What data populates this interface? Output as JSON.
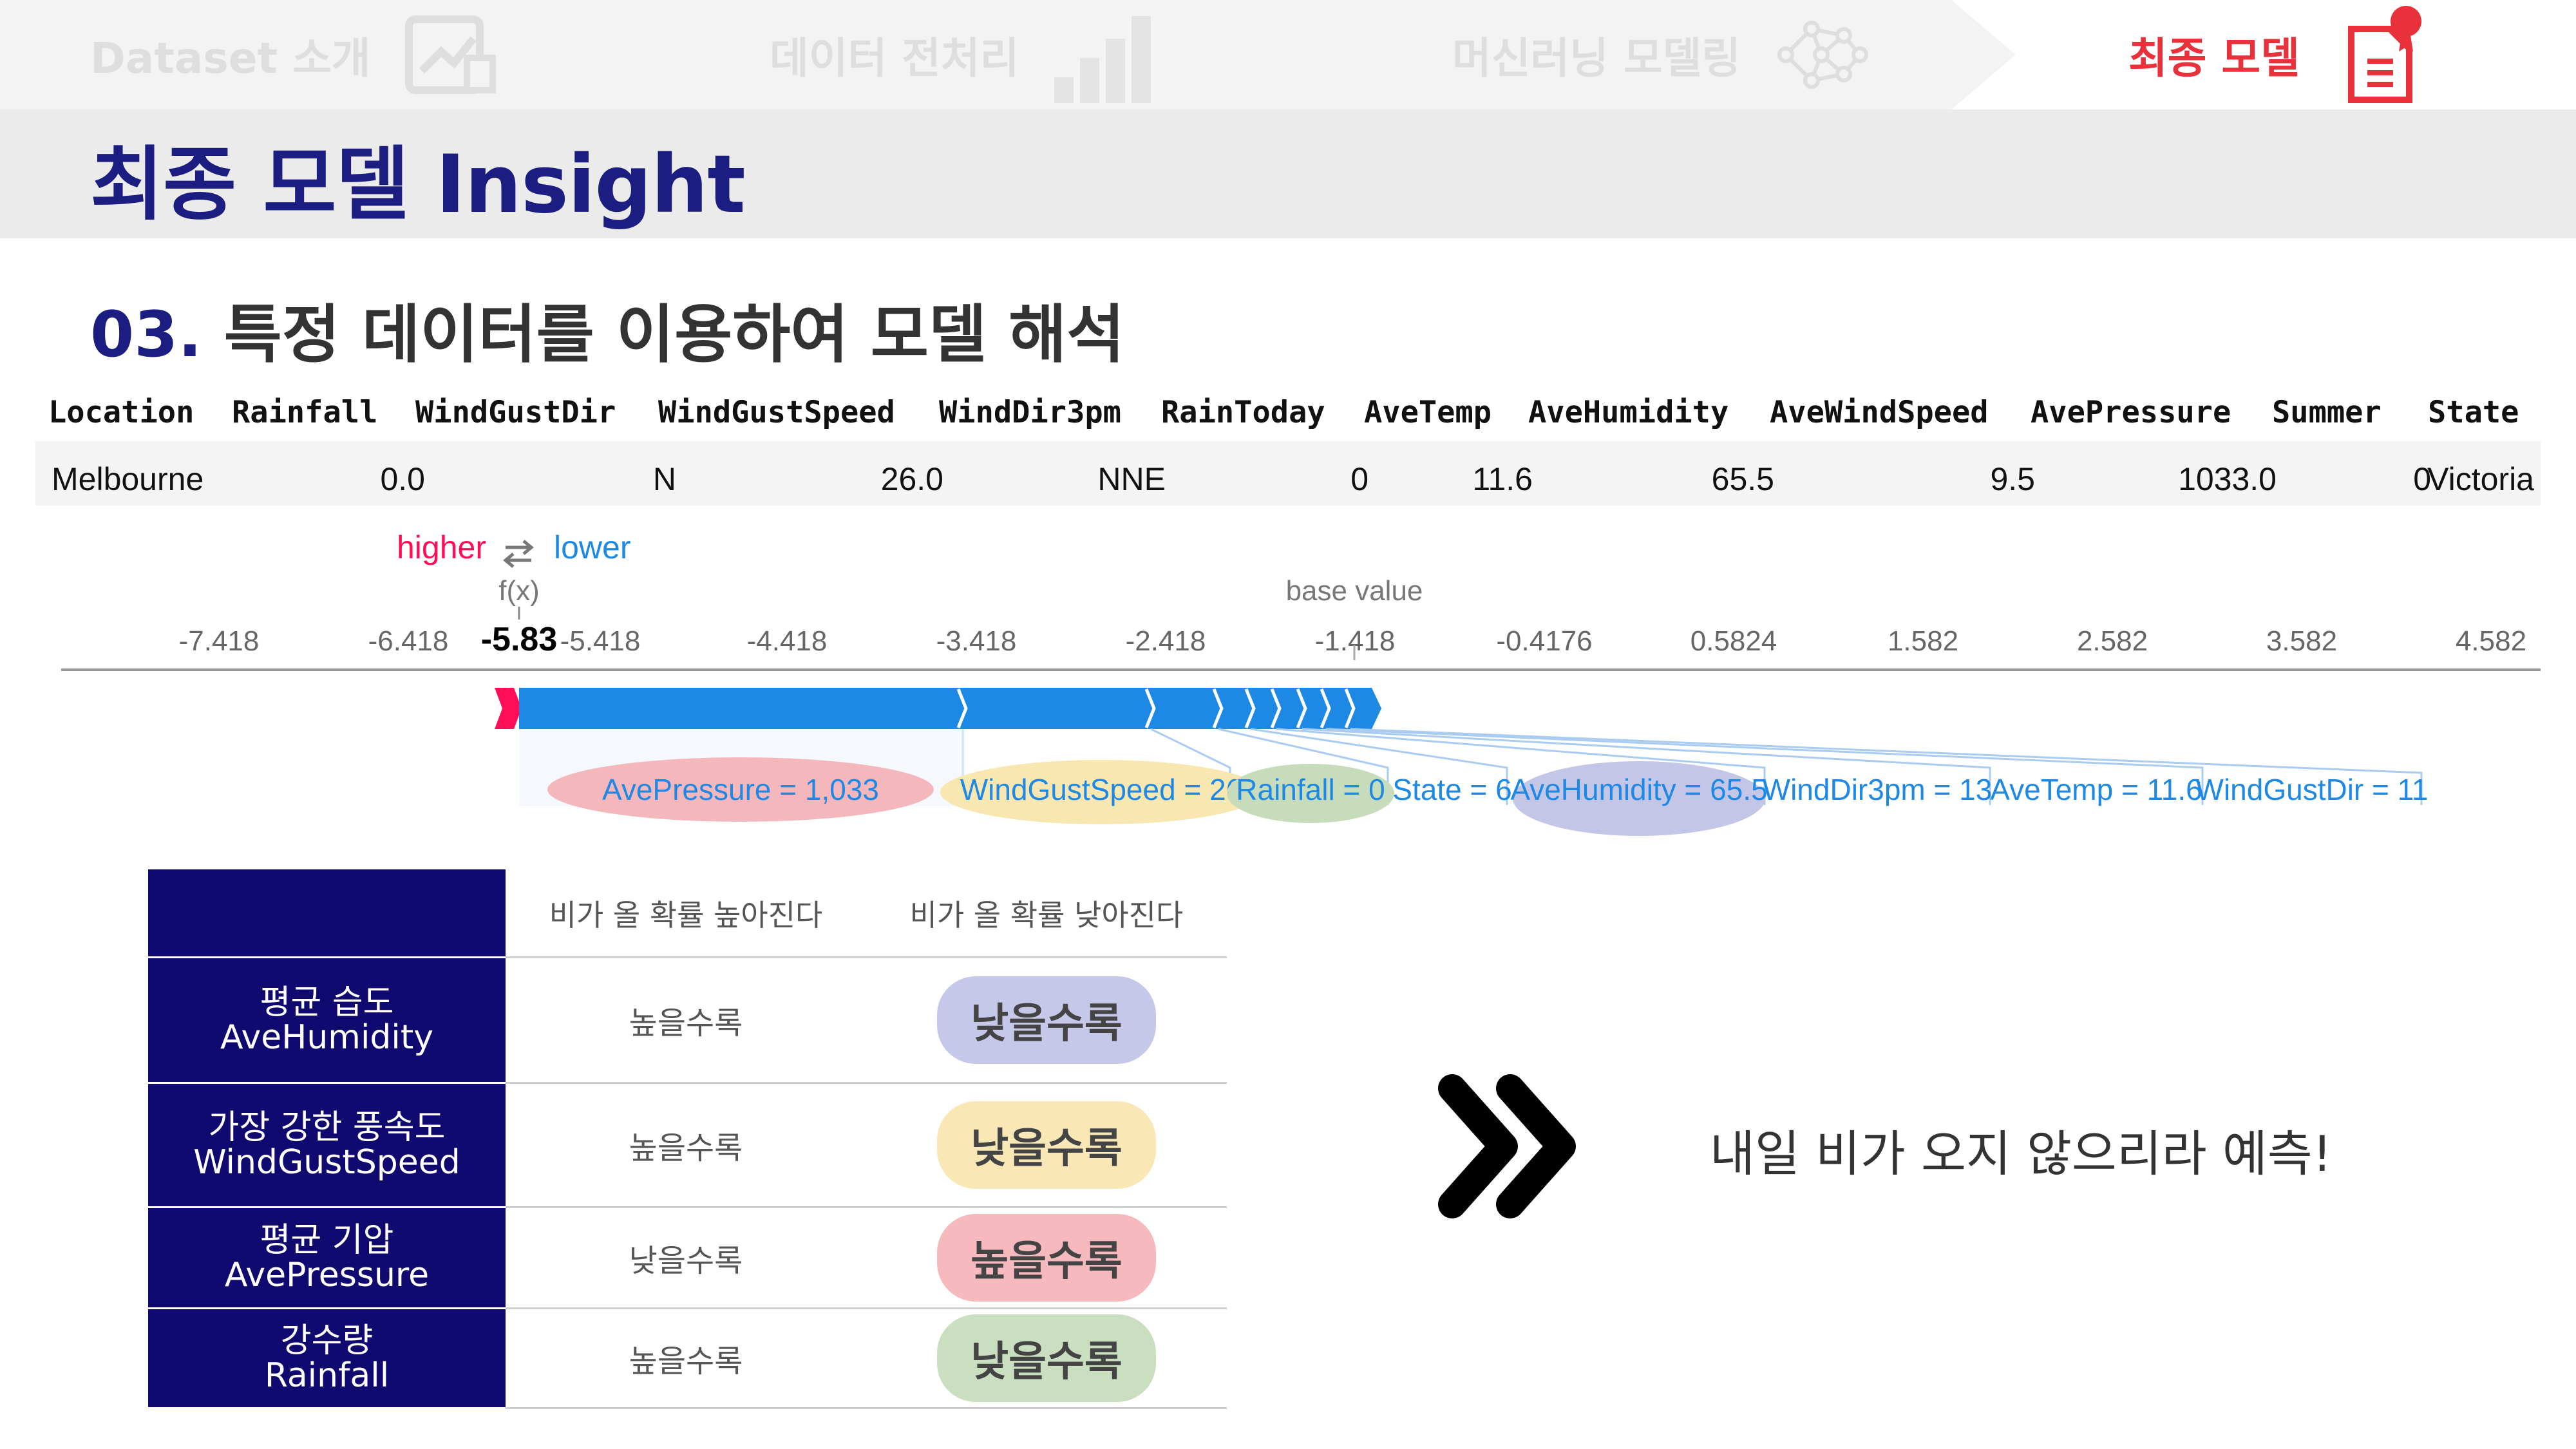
{
  "nav": {
    "steps": [
      {
        "label": "Dataset 소개",
        "icon": "chart-document-icon",
        "active": false
      },
      {
        "label": "데이터 전처리",
        "icon": "bar-chart-icon",
        "active": false
      },
      {
        "label": "머신러닝 모델링",
        "icon": "network-icon",
        "active": false
      },
      {
        "label": "최종 모델",
        "icon": "certificate-document-icon",
        "active": true
      }
    ],
    "accent_color": "#e8313a",
    "inactive_color": "#dedede"
  },
  "page_title": "최종 모델 Insight",
  "section": {
    "number": "03.",
    "title": "특정 데이터를 이용하여 모델 해석"
  },
  "data_row": {
    "columns": [
      "Location",
      "Rainfall",
      "WindGustDir",
      "WindGustSpeed",
      "WindDir3pm",
      "RainToday",
      "AveTemp",
      "AveHumidity",
      "AveWindSpeed",
      "AvePressure",
      "Summer",
      "State"
    ],
    "values": [
      "Melbourne",
      "0.0",
      "N",
      "26.0",
      "NNE",
      "0",
      "11.6",
      "65.5",
      "9.5",
      "1033.0",
      "0",
      "Victoria"
    ]
  },
  "force_plot": {
    "legend_higher": "higher",
    "legend_lower": "lower",
    "fx_label": "f(x)",
    "fx_value": "-5.83",
    "base_value_label": "base value",
    "ticks": [
      "-7.418",
      "-6.418",
      "-5.418",
      "-4.418",
      "-3.418",
      "-2.418",
      "-1.418",
      "-0.4176",
      "0.5824",
      "1.582",
      "2.582",
      "3.582",
      "4.582"
    ],
    "features": [
      {
        "label": "AvePressure = 1,033",
        "highlight": "#f4b8bc"
      },
      {
        "label": "WindGustSpeed = 26",
        "highlight": "#f8e7b0"
      },
      {
        "label": "Rainfall = 0",
        "highlight": "#c6dcbb"
      },
      {
        "label": "State = 6",
        "highlight": ""
      },
      {
        "label": "AveHumidity = 65.5",
        "highlight": "#c3c6e6"
      },
      {
        "label": "WindDir3pm = 13",
        "highlight": ""
      },
      {
        "label": "AveTemp = 11.6",
        "highlight": ""
      },
      {
        "label": "WindGustDir = 11",
        "highlight": ""
      }
    ],
    "higher_color": "#ff0d57",
    "lower_color": "#1e88e5"
  },
  "insight_table": {
    "header_higher": "비가 올 확률 높아진다",
    "header_lower": "비가 올 확률 낮아진다",
    "rows": [
      {
        "ko": "평균 습도",
        "en": "AveHumidity",
        "higher": "높을수록",
        "lower": "낮을수록",
        "pill": "#c5c8e8"
      },
      {
        "ko": "가장 강한 풍속도",
        "en": "WindGustSpeed",
        "higher": "높을수록",
        "lower": "낮을수록",
        "pill": "#f9e8b6"
      },
      {
        "ko": "평균 기압",
        "en": "AvePressure",
        "higher": "낮을수록",
        "lower": "높을수록",
        "pill": "#f6b9bd"
      },
      {
        "ko": "강수량",
        "en": "Rainfall",
        "higher": "높을수록",
        "lower": "낮을수록",
        "pill": "#c9dfbf"
      }
    ]
  },
  "conclusion": "내일 비가 오지 않으리라 예측!"
}
